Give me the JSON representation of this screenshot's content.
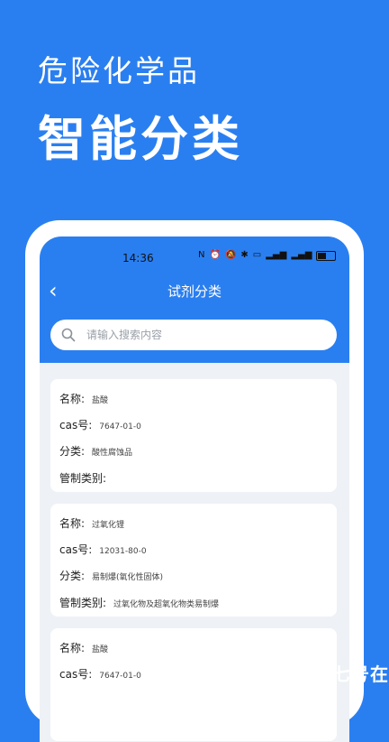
{
  "promo": {
    "line1": "危险化学品",
    "line2": "智能分类"
  },
  "status_bar": {
    "time": "14:36",
    "icons": [
      "nfc-icon",
      "alarm-icon",
      "mute-icon",
      "bluetooth-icon",
      "hd-icon",
      "signal-icon",
      "signal-icon",
      "wifi-icon",
      "battery-icon"
    ]
  },
  "app_header": {
    "title": "试剂分类",
    "back_glyph": "‹"
  },
  "search": {
    "placeholder": "请输入搜索内容",
    "value": ""
  },
  "field_labels": {
    "name": "名称:",
    "cas": "cas号:",
    "category": "分类:",
    "control": "管制类别:"
  },
  "items": [
    {
      "name": "盐酸",
      "cas": "7647-01-0",
      "category": "酸性腐蚀品",
      "control": ""
    },
    {
      "name": "过氧化锂",
      "cas": "12031-80-0",
      "category": "易制爆(氧化性固体)",
      "control": "过氧化物及超氧化物类易制爆"
    },
    {
      "name": "盐酸",
      "cas": "7647-01-0",
      "category": "",
      "control": ""
    }
  ],
  "watermark": {
    "text": "七号在"
  }
}
